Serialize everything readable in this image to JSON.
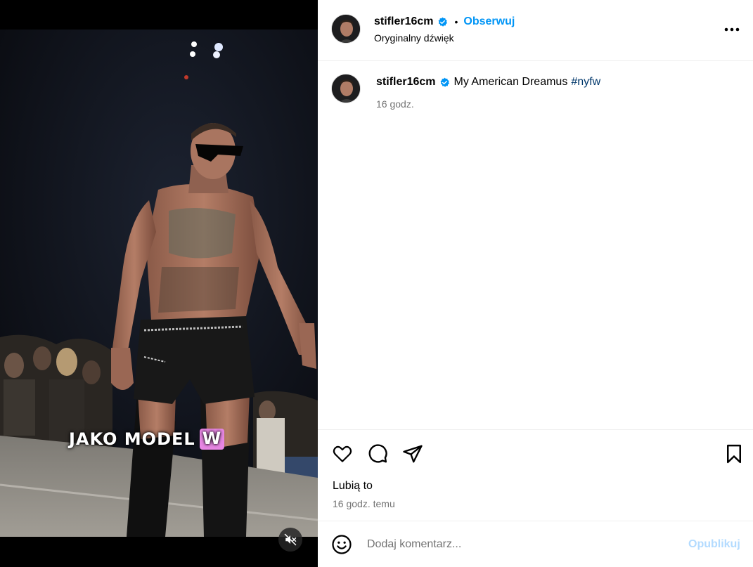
{
  "media": {
    "overlay_text": "JAKO MODEL",
    "overlay_badge": "W",
    "mute_icon": "speaker-muted-icon"
  },
  "header": {
    "username": "stifler16cm",
    "verified_icon": "verified-badge-icon",
    "separator": "•",
    "follow_label": "Obserwuj",
    "audio_label": "Oryginalny dźwięk",
    "more_icon": "more-horizontal-icon"
  },
  "caption": {
    "username": "stifler16cm",
    "text": "My American Dreamus",
    "hashtag": "#nyfw",
    "time": "16 godz."
  },
  "actions": {
    "like_icon": "heart-icon",
    "comment_icon": "comment-icon",
    "share_icon": "share-icon",
    "save_icon": "bookmark-icon",
    "likes_label": "Lubią to",
    "post_time": "16 godz. temu"
  },
  "comment_box": {
    "emoji_icon": "emoji-icon",
    "placeholder": "Dodaj komentarz...",
    "publish_label": "Opublikuj"
  },
  "colors": {
    "accent": "#0095f6",
    "hashtag": "#00376b",
    "muted_text": "#737373",
    "publish_disabled": "#b3dbff",
    "badge_pink": "#e887e4"
  }
}
